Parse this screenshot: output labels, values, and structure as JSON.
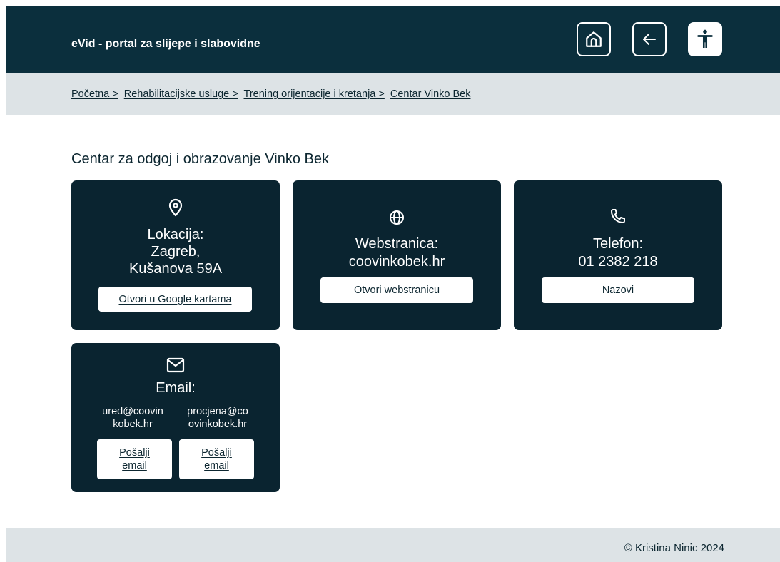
{
  "header": {
    "title": "eVid - portal za slijepe i slabovidne",
    "buttons": {
      "home_icon": "home-icon",
      "back_icon": "arrow-left-icon",
      "accessibility_icon": "accessibility-icon"
    }
  },
  "breadcrumb": [
    "Početna >",
    "Rehabilitacijske usluge >",
    "Trening orijentacije i kretanja >",
    "Centar Vinko Bek"
  ],
  "page": {
    "heading": "Centar za odgoj i obrazovanje Vinko Bek"
  },
  "cards": {
    "location": {
      "icon": "location-pin-icon",
      "label": "Lokacija:",
      "lines": [
        "Zagreb,",
        "Kušanova 59A"
      ],
      "button": "Otvori u Google kartama"
    },
    "website": {
      "icon": "globe-icon",
      "label": "Webstranica:",
      "value": "coovinkobek.hr",
      "button": "Otvori webstranicu"
    },
    "phone": {
      "icon": "phone-icon",
      "label": "Telefon:",
      "value": "01 2382 218",
      "button": "Nazovi"
    },
    "email": {
      "icon": "mail-icon",
      "label": "Email:",
      "addresses": [
        {
          "lines": [
            "ured@coovin",
            "kobek.hr"
          ],
          "button_lines": [
            "Pošalji",
            "email"
          ]
        },
        {
          "lines": [
            "procjena@co",
            "ovinkobek.hr"
          ],
          "button_lines": [
            "Pošalji",
            "email"
          ]
        }
      ]
    }
  },
  "footer": {
    "copyright": "© Kristina Ninic 2024"
  },
  "colors": {
    "header_bg": "#0b2f3d",
    "card_bg": "#0a2430",
    "bar_bg": "#dde3e6",
    "text": "#0c2630"
  }
}
